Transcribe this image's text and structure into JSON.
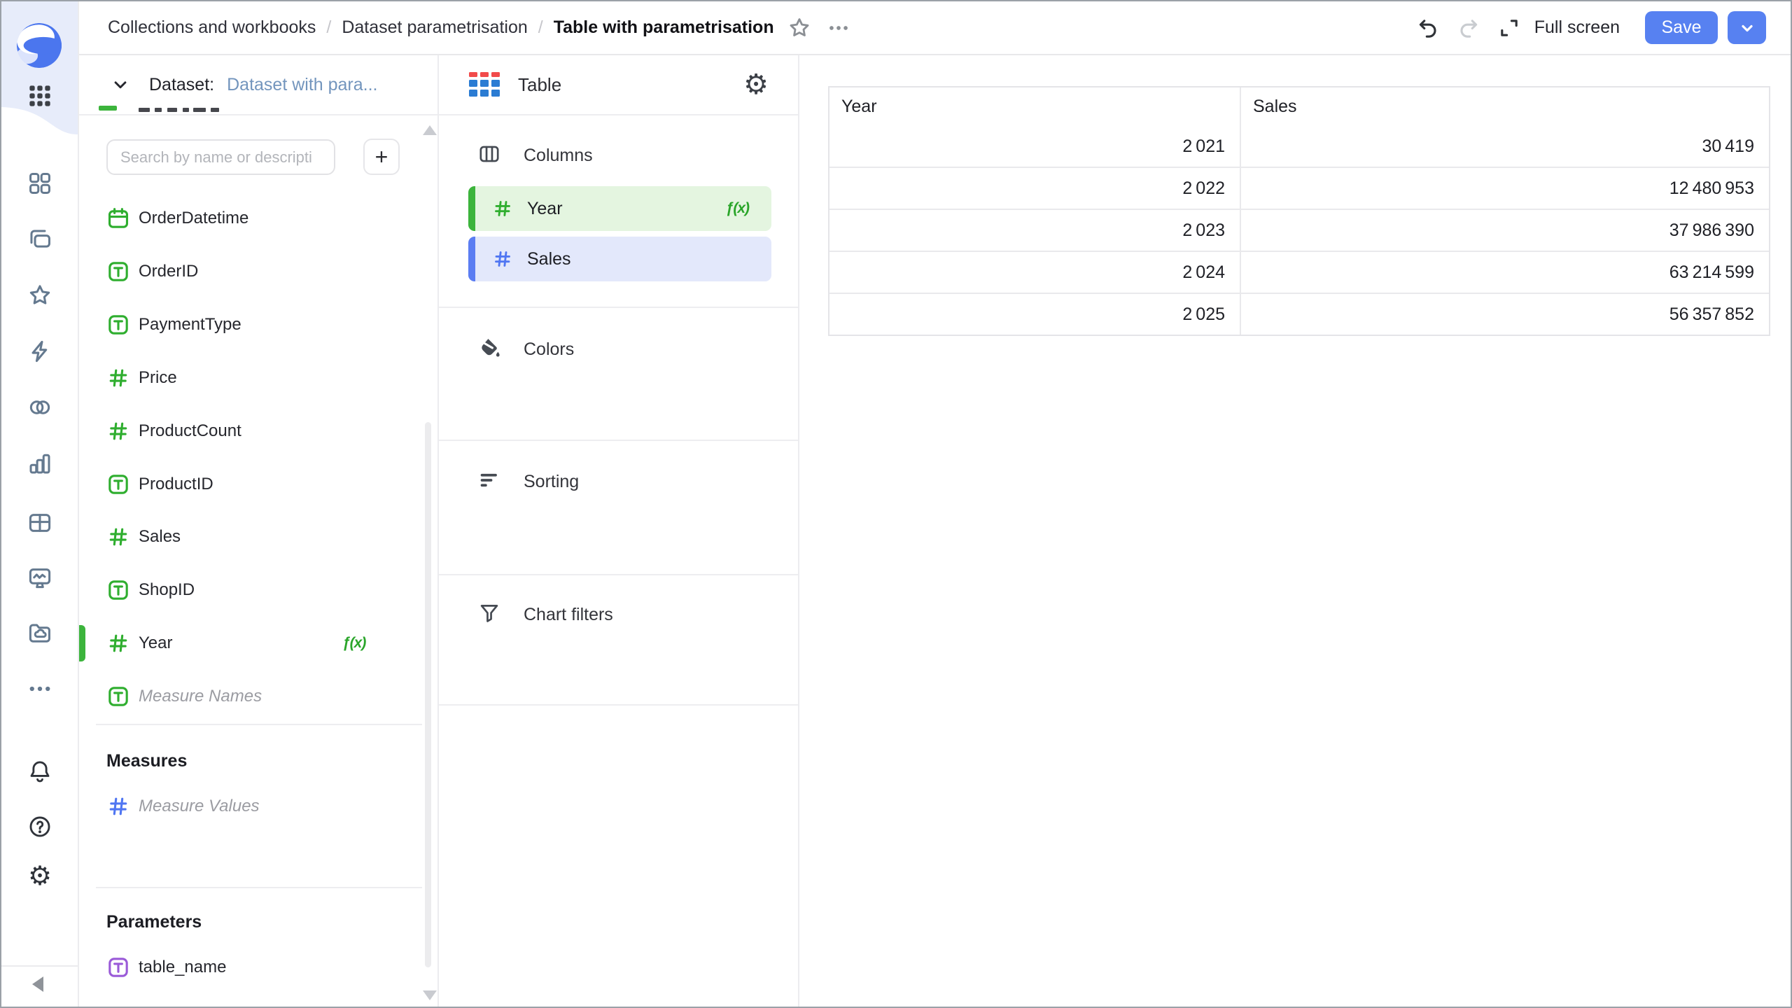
{
  "topbar": {
    "breadcrumbs": [
      "Collections and workbooks",
      "Dataset parametrisation",
      "Table with parametrisation"
    ],
    "separator": "/",
    "full_screen_label": "Full screen",
    "save_label": "Save"
  },
  "rail": {
    "items": [
      {
        "icon": "grid4-icon"
      },
      {
        "icon": "collections-icon"
      },
      {
        "icon": "star-icon"
      },
      {
        "icon": "lightning-icon"
      },
      {
        "icon": "connections-icon"
      },
      {
        "icon": "bar-chart-icon"
      },
      {
        "icon": "table-grid-icon"
      },
      {
        "icon": "monitor-icon"
      },
      {
        "icon": "folder-cloud-icon"
      },
      {
        "icon": "more-dots-icon"
      }
    ],
    "bottom_items": [
      {
        "icon": "bell-icon"
      },
      {
        "icon": "question-icon"
      },
      {
        "icon": "gear-icon"
      }
    ]
  },
  "dataset_panel": {
    "label": "Dataset:",
    "dataset_name": "Dataset with para...",
    "search_placeholder": "Search by name or descripti",
    "add_button_label": "+",
    "formula_badge": "ƒ(x)",
    "fields": [
      {
        "name": "OrderDatetime",
        "icon": "calendar",
        "color": "green"
      },
      {
        "name": "OrderID",
        "icon": "boxT",
        "color": "green"
      },
      {
        "name": "PaymentType",
        "icon": "boxT",
        "color": "green"
      },
      {
        "name": "Price",
        "icon": "hash",
        "color": "green"
      },
      {
        "name": "ProductCount",
        "icon": "hash",
        "color": "green"
      },
      {
        "name": "ProductID",
        "icon": "boxT",
        "color": "green"
      },
      {
        "name": "Sales",
        "icon": "hash",
        "color": "green"
      },
      {
        "name": "ShopID",
        "icon": "boxT",
        "color": "green"
      },
      {
        "name": "Year",
        "icon": "hash",
        "color": "green",
        "formula": true,
        "active": true
      },
      {
        "name": "Measure Names",
        "icon": "boxT",
        "color": "green",
        "italic": true
      }
    ],
    "measures_heading": "Measures",
    "measures": [
      {
        "name": "Measure Values",
        "icon": "hash",
        "color": "blue",
        "italic": true
      }
    ],
    "parameters_heading": "Parameters",
    "parameters": [
      {
        "name": "table_name",
        "icon": "boxT",
        "color": "purple"
      }
    ]
  },
  "viz_panel": {
    "type_label": "Table",
    "sections": {
      "columns": {
        "label": "Columns"
      },
      "colors": {
        "label": "Colors"
      },
      "sorting": {
        "label": "Sorting"
      },
      "chart_filters": {
        "label": "Chart filters"
      }
    },
    "columns_chips": [
      {
        "name": "Year",
        "color": "green",
        "formula": true
      },
      {
        "name": "Sales",
        "color": "blue"
      }
    ]
  },
  "preview_table": {
    "columns": [
      "Year",
      "Sales"
    ],
    "rows": [
      [
        "2 021",
        "30 419"
      ],
      [
        "2 022",
        "12 480 953"
      ],
      [
        "2 023",
        "37 986 390"
      ],
      [
        "2 024",
        "63 214 599"
      ],
      [
        "2 025",
        "56 357 852"
      ]
    ]
  },
  "colors": {
    "accent_green": "#2fae2f",
    "accent_blue": "#5076f2",
    "param_purple": "#9a5ad8",
    "chip_green_bg": "#e4f5e0",
    "chip_blue_bg": "#e3e8fb",
    "chip_green_bar": "#3cb43c",
    "chip_blue_bar": "#5b7df2",
    "link_blue": "#7395bd",
    "save_blue": "#5781f1",
    "rail_slate": "#64798f",
    "rail_dark": "#2f333a",
    "topbar_dark": "#2f3237",
    "disabled_gray": "#c9ccd0",
    "muted_gray": "#8b8f94"
  }
}
